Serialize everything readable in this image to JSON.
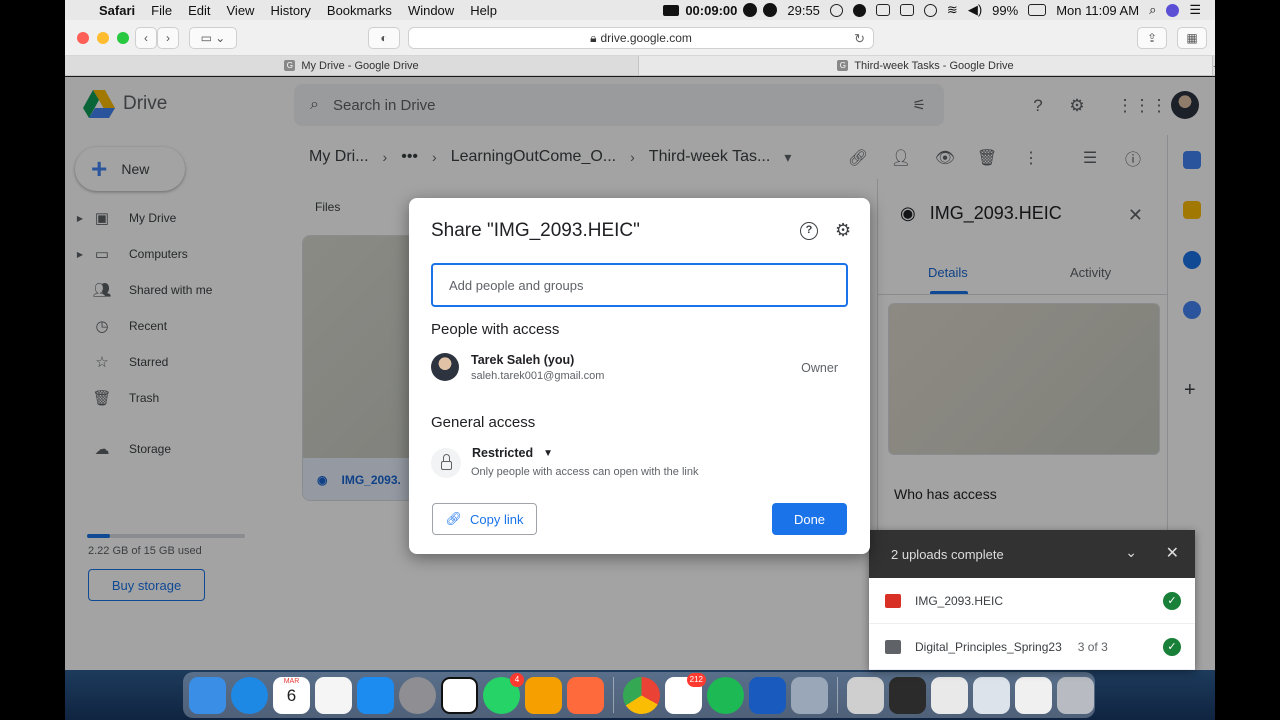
{
  "menubar": {
    "app": "Safari",
    "items": [
      "File",
      "Edit",
      "View",
      "History",
      "Bookmarks",
      "Window",
      "Help"
    ],
    "record_time": "00:09:00",
    "timer": "29:55",
    "battery": "99%",
    "clock": "Mon 11:09 AM"
  },
  "browser": {
    "url": "drive.google.com",
    "tabs": [
      {
        "label": "My Drive - Google Drive"
      },
      {
        "label": "Third-week Tasks - Google Drive"
      }
    ],
    "tab_new": "+"
  },
  "drive": {
    "logo_text": "Drive",
    "search_placeholder": "Search in Drive",
    "new_label": "New",
    "nav": [
      {
        "label": "My Drive"
      },
      {
        "label": "Computers"
      },
      {
        "label": "Shared with me"
      },
      {
        "label": "Recent"
      },
      {
        "label": "Starred"
      },
      {
        "label": "Trash"
      },
      {
        "label": "Storage"
      }
    ],
    "storage_used_fraction": 0.148,
    "storage_text": "2.22 GB of 15 GB used",
    "buy_storage": "Buy storage",
    "breadcrumb": [
      "My Dri...",
      "•••",
      "LearningOutCome_O...",
      "Third-week Tas..."
    ],
    "files_label": "Files",
    "file_name": "IMG_2093.",
    "details": {
      "title": "IMG_2093.HEIC",
      "tab_details": "Details",
      "tab_activity": "Activity",
      "who_has_access": "Who has access"
    }
  },
  "uploads": {
    "header": "2 uploads complete",
    "items": [
      {
        "name": "IMG_2093.HEIC",
        "count": ""
      },
      {
        "name": "Digital_Principles_Spring23",
        "count": "3 of 3"
      }
    ]
  },
  "share_dialog": {
    "title": "Share \"IMG_2093.HEIC\"",
    "input_placeholder": "Add people and groups",
    "people_heading": "People with access",
    "person": {
      "name": "Tarek Saleh (you)",
      "email": "saleh.tarek001@gmail.com",
      "role": "Owner"
    },
    "general_heading": "General access",
    "access_level": "Restricted",
    "access_desc": "Only people with access can open with the link",
    "copy_link": "Copy link",
    "done": "Done"
  },
  "dock": {
    "calendar_day": "6",
    "calendar_month": "MAR",
    "whatsapp_badge": "4",
    "slack_badge": "212"
  },
  "colors": {
    "accent": "#1a73e8",
    "success": "#188038",
    "toast_header": "#323232"
  }
}
